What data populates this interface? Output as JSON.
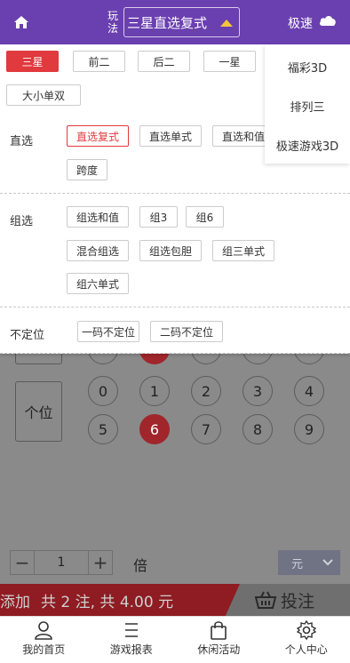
{
  "header": {
    "play_label": "玩法",
    "mode_value": "三星直选复式",
    "speed_label": "极速"
  },
  "tabs": [
    {
      "label": "三星",
      "active": true
    },
    {
      "label": "前二",
      "active": false
    },
    {
      "label": "后二",
      "active": false
    },
    {
      "label": "一星",
      "active": false
    },
    {
      "label": "大小单双",
      "active": false
    }
  ],
  "panel": {
    "groups": [
      {
        "title": "直选",
        "options": [
          "直选复式",
          "直选单式",
          "直选和值",
          "跨度"
        ]
      },
      {
        "title": "组选",
        "options": [
          "组选和值",
          "组3",
          "组6",
          "混合组选",
          "组选包胆",
          "组三单式",
          "组六单式"
        ]
      },
      {
        "title": "不定位",
        "options": [
          "一码不定位",
          "二码不定位"
        ]
      }
    ],
    "active_option": "直选复式"
  },
  "menu": {
    "items": [
      "福彩3D",
      "排列三",
      "极速游戏3D"
    ]
  },
  "board": {
    "position_label": "个位",
    "balls": [
      "0",
      "1",
      "2",
      "3",
      "4",
      "5",
      "6",
      "7",
      "8",
      "9"
    ],
    "selected": "6"
  },
  "multiplier": {
    "minus": "−",
    "value": "1",
    "plus": "+",
    "unit_label": "倍",
    "currency_unit": "元"
  },
  "bet_bar": {
    "add_label": "添加",
    "summary": "共 2 注, 共 4.00 元",
    "submit_label": "投注"
  },
  "bottom_nav": [
    {
      "label": "我的首页",
      "icon": "user-icon"
    },
    {
      "label": "游戏报表",
      "icon": "list-icon"
    },
    {
      "label": "休闲活动",
      "icon": "bag-icon"
    },
    {
      "label": "个人中心",
      "icon": "gear-icon"
    }
  ],
  "colors": {
    "header_bg": "#6a3fb0",
    "accent_red": "#e0393e",
    "triangle_yellow": "#f3c53a"
  }
}
